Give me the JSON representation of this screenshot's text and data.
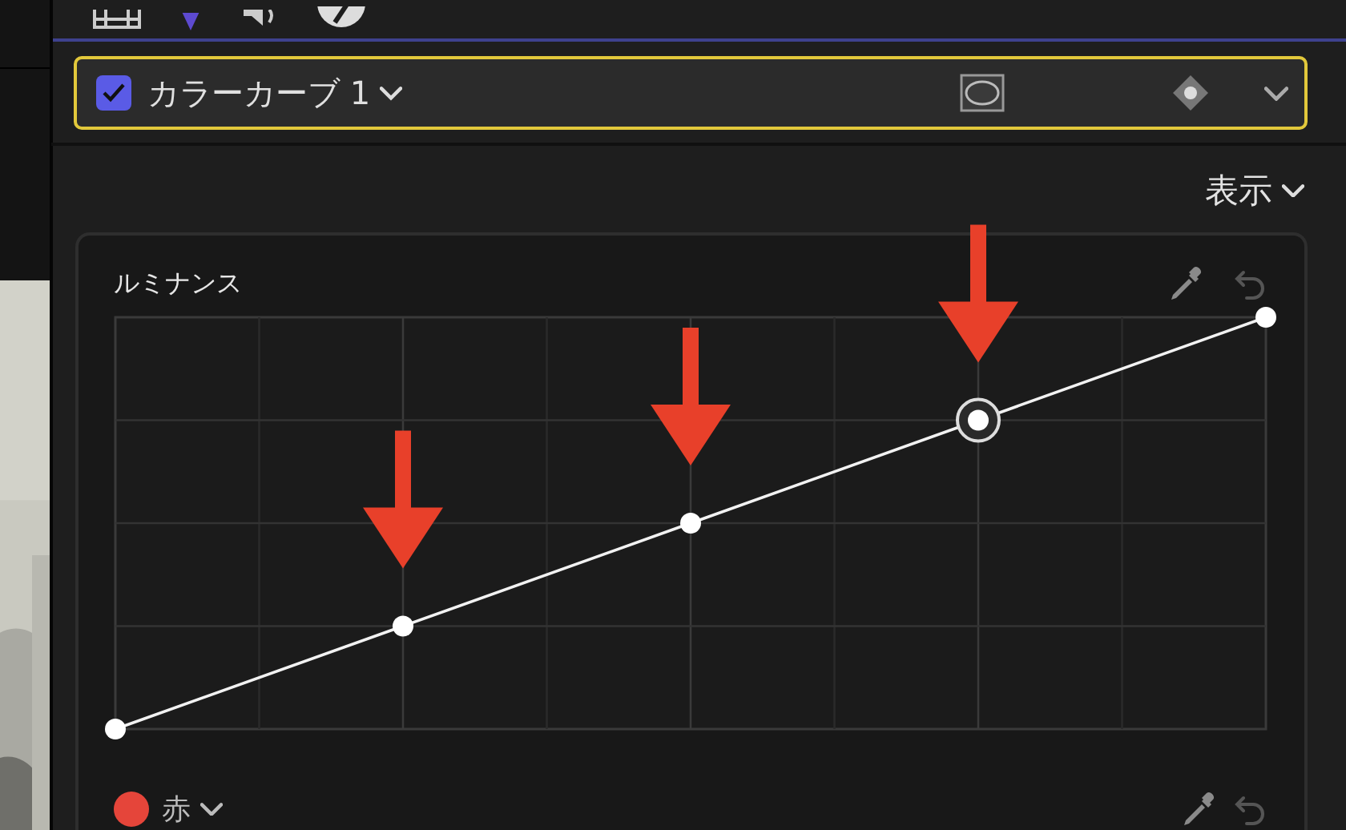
{
  "effect": {
    "enabled": true,
    "name": "カラーカーブ 1"
  },
  "view_menu": {
    "label": "表示"
  },
  "curves": [
    {
      "kind": "luminance",
      "title": "ルミナンス",
      "control_points": [
        {
          "selected": false
        },
        {
          "selected": false
        },
        {
          "selected": false
        },
        {
          "selected": true
        },
        {
          "selected": false
        }
      ]
    },
    {
      "kind": "channel",
      "title": "赤",
      "color": "#e5453a"
    }
  ]
}
